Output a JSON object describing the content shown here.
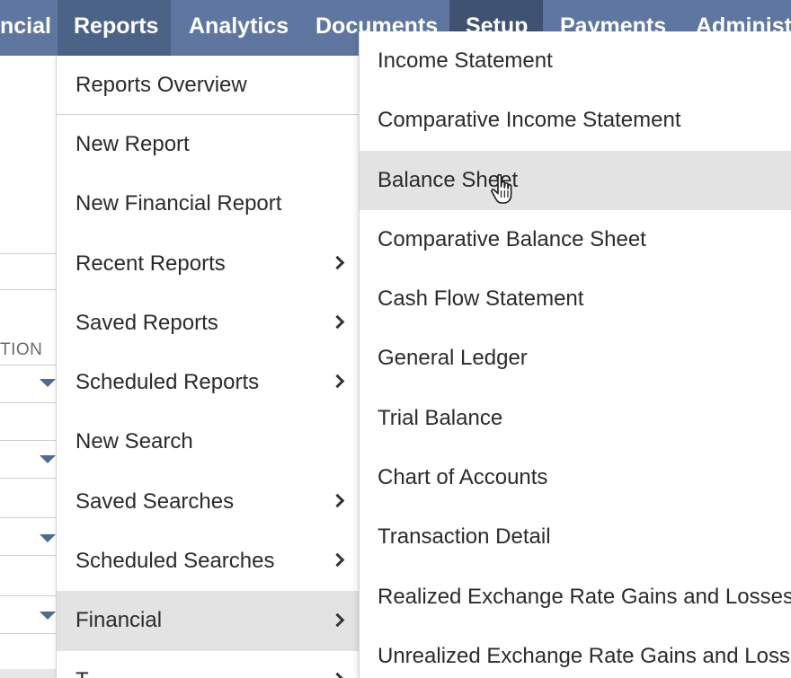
{
  "topnav": {
    "items": [
      {
        "label": "ncial"
      },
      {
        "label": "Reports"
      },
      {
        "label": "Analytics"
      },
      {
        "label": "Documents"
      },
      {
        "label": "Setup"
      },
      {
        "label": "Payments"
      },
      {
        "label": "Administr"
      }
    ]
  },
  "background": {
    "column_header": "TION"
  },
  "reports_menu": {
    "items": [
      {
        "label": "Reports Overview",
        "submenu": false
      },
      {
        "label": "New Report",
        "submenu": false
      },
      {
        "label": "New Financial Report",
        "submenu": false
      },
      {
        "label": "Recent Reports",
        "submenu": true
      },
      {
        "label": "Saved Reports",
        "submenu": true
      },
      {
        "label": "Scheduled Reports",
        "submenu": true
      },
      {
        "label": "New Search",
        "submenu": false
      },
      {
        "label": "Saved Searches",
        "submenu": true
      },
      {
        "label": "Scheduled Searches",
        "submenu": true
      },
      {
        "label": "Financial",
        "submenu": true,
        "highlighted": true
      },
      {
        "label": "T",
        "submenu": true
      }
    ]
  },
  "financial_menu": {
    "items": [
      {
        "label": "Income Statement"
      },
      {
        "label": "Comparative Income Statement"
      },
      {
        "label": "Balance Sheet",
        "hovered": true
      },
      {
        "label": "Comparative Balance Sheet"
      },
      {
        "label": "Cash Flow Statement"
      },
      {
        "label": "General Ledger"
      },
      {
        "label": "Trial Balance"
      },
      {
        "label": "Chart of Accounts"
      },
      {
        "label": "Transaction Detail"
      },
      {
        "label": "Realized Exchange Rate Gains and Losses"
      },
      {
        "label": "Unrealized Exchange Rate Gains and Losses"
      }
    ]
  },
  "colors": {
    "nav_bg": "#5f77a0",
    "nav_active": "#4c6388",
    "nav_setup": "#3f5272",
    "hover_bg": "#e3e3e3"
  }
}
